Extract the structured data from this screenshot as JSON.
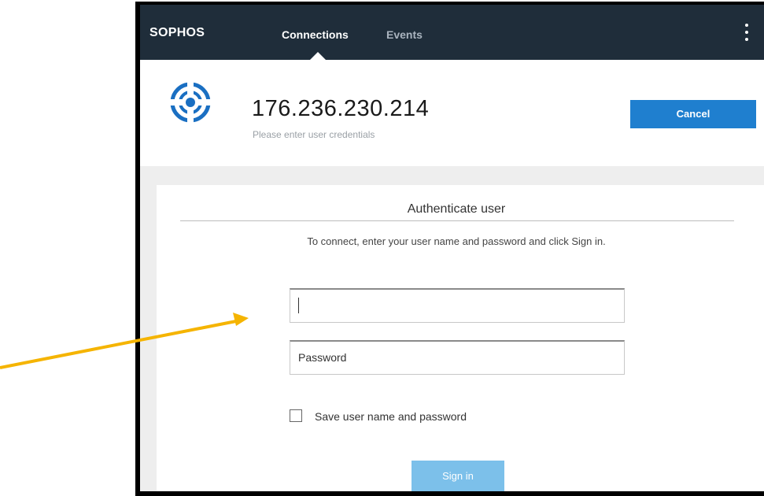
{
  "app": {
    "brand": "SOPHOS",
    "tabs": [
      {
        "label": "Connections",
        "active": true
      },
      {
        "label": "Events",
        "active": false
      }
    ],
    "menu_icon": "kebab-menu-icon"
  },
  "connection": {
    "ip": "176.236.230.214",
    "subtitle": "Please enter user credentials",
    "cancel_label": "Cancel",
    "icon": "connection-target-icon"
  },
  "auth": {
    "title": "Authenticate user",
    "instructions": "To connect, enter your user name and password and click Sign in.",
    "username_value": "",
    "password_placeholder": "Password",
    "save_label": "Save user name and password",
    "save_checked": false,
    "signin_label": "Sign in"
  },
  "colors": {
    "topbar": "#1f2d3a",
    "accent": "#1f7fcf",
    "signin_disabled": "#7cc0ea",
    "annotation_arrow": "#f5b400"
  }
}
